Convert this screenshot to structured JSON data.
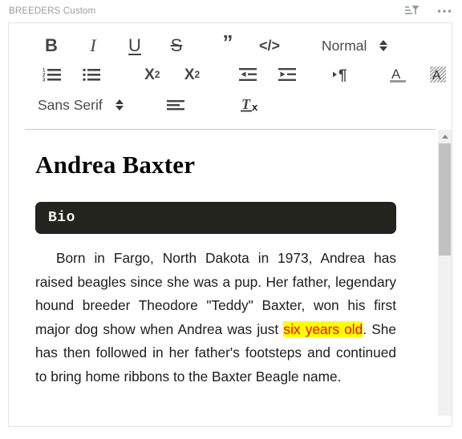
{
  "header": {
    "title": "BREEDERS Custom",
    "actions": [
      {
        "name": "sort-filter-icon",
        "label": "Sort and filter"
      },
      {
        "name": "more-options-icon",
        "label": "More options"
      }
    ]
  },
  "toolbar": {
    "rows": [
      {
        "items": [
          {
            "name": "bold-button",
            "glyph": "B",
            "label": "Bold"
          },
          {
            "name": "italic-button",
            "glyph": "I",
            "label": "Italic"
          },
          {
            "name": "underline-button",
            "glyph": "U",
            "label": "Underline"
          },
          {
            "name": "strikethrough-button",
            "glyph": "S",
            "label": "Strikethrough"
          },
          {
            "name": "blockquote-button",
            "glyph": "”",
            "label": "Blockquote"
          },
          {
            "name": "code-block-button",
            "glyph": "</>",
            "label": "Code block"
          },
          {
            "name": "paragraph-style-select",
            "value": "Normal",
            "label": "Paragraph style"
          }
        ]
      },
      {
        "items": [
          {
            "name": "ordered-list-button",
            "label": "Numbered list"
          },
          {
            "name": "bullet-list-button",
            "label": "Bulleted list"
          },
          {
            "name": "subscript-button",
            "glyph": "X",
            "sub": "2",
            "label": "Subscript"
          },
          {
            "name": "superscript-button",
            "glyph": "X",
            "sup": "2",
            "label": "Superscript"
          },
          {
            "name": "outdent-button",
            "label": "Decrease indent"
          },
          {
            "name": "indent-button",
            "label": "Increase indent"
          },
          {
            "name": "text-direction-button",
            "glyph": "¶",
            "label": "Text direction"
          },
          {
            "name": "text-color-button",
            "glyph": "A",
            "label": "Text color"
          },
          {
            "name": "highlight-color-button",
            "glyph": "A",
            "label": "Highlight color"
          }
        ]
      },
      {
        "items": [
          {
            "name": "font-family-select",
            "value": "Sans Serif",
            "label": "Font family"
          },
          {
            "name": "align-button",
            "label": "Alignment"
          },
          {
            "name": "clear-formatting-button",
            "glyph": "T",
            "sub": "x",
            "label": "Clear formatting"
          }
        ]
      }
    ]
  },
  "document": {
    "title": "Andrea Baxter",
    "section_heading": "Bio",
    "paragraph": {
      "before_highlight": "Born in Fargo, North Dakota in 1973, Andrea has raised beagles since she was a pup. Her father, legendary hound breeder Theodore \"Teddy\" Baxter, won his first major dog show when Andrea was just ",
      "highlight": "six years old",
      "after_highlight": ". She has then followed in her father's footsteps and continued to bring home ribbons to the Baxter Beagle name."
    }
  },
  "colors": {
    "header_text": "#9b9b9b",
    "card_border": "#e3e3e3",
    "toolbar_icon": "#444444",
    "heading_block_bg": "#23241e",
    "heading_block_text": "#f4f4ef",
    "highlight_bg": "#FFFF00",
    "highlight_text": "#FF0000",
    "scrollbar_track": "#f1f1f1",
    "scrollbar_thumb": "#c1c1c1"
  },
  "scrollbar": {
    "up_arrow_name": "scroll-up-arrow",
    "thumb_name": "scroll-thumb"
  }
}
